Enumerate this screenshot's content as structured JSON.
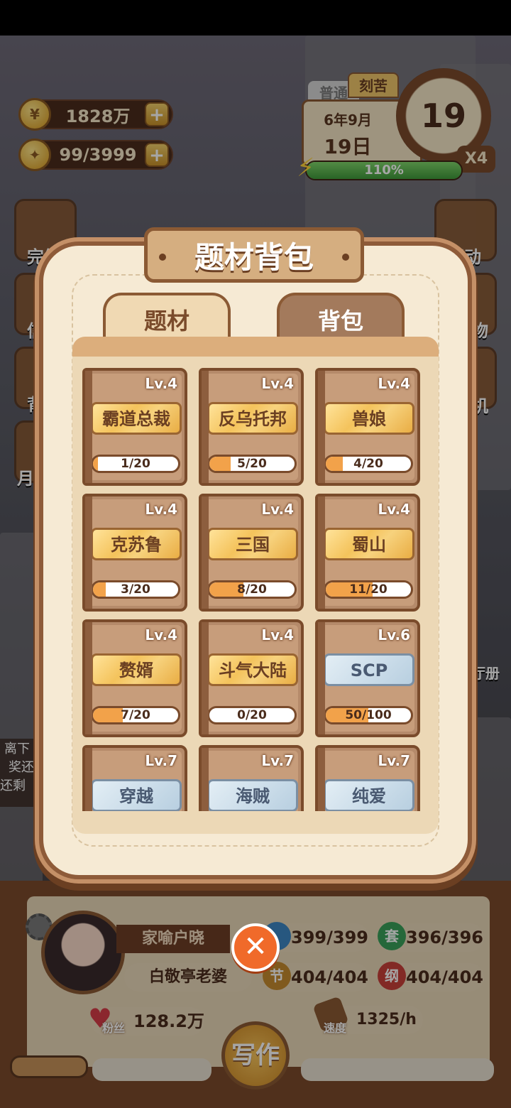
{
  "resources": {
    "coins": "1828万",
    "ideas": "99/3999"
  },
  "date_panel": {
    "tag_normal": "普通",
    "tag_hard": "刻苦",
    "month": "6年9月",
    "day": "19日",
    "clock_day": "19",
    "speed": "X4",
    "energy": "110%",
    "energy_fraction": 1.0
  },
  "side_left": [
    "完结",
    "信",
    "背",
    "月"
  ],
  "side_right": [
    "行动",
    "物",
    "机",
    "厅册"
  ],
  "side_left_extra": [
    "离下",
    "奖还",
    "还剩"
  ],
  "modal": {
    "title": "题材背包",
    "tabs": [
      {
        "label": "题材",
        "active": true
      },
      {
        "label": "背包",
        "active": false
      }
    ],
    "items": [
      {
        "name": "霸道总裁",
        "level": "Lv.4",
        "progress": "1/20",
        "fraction": 0.05,
        "style": "gold"
      },
      {
        "name": "反乌托邦",
        "level": "Lv.4",
        "progress": "5/20",
        "fraction": 0.25,
        "style": "gold"
      },
      {
        "name": "兽娘",
        "level": "Lv.4",
        "progress": "4/20",
        "fraction": 0.2,
        "style": "gold"
      },
      {
        "name": "克苏鲁",
        "level": "Lv.4",
        "progress": "3/20",
        "fraction": 0.15,
        "style": "gold"
      },
      {
        "name": "三国",
        "level": "Lv.4",
        "progress": "8/20",
        "fraction": 0.4,
        "style": "gold"
      },
      {
        "name": "蜀山",
        "level": "Lv.4",
        "progress": "11/20",
        "fraction": 0.55,
        "style": "gold"
      },
      {
        "name": "赘婿",
        "level": "Lv.4",
        "progress": "7/20",
        "fraction": 0.35,
        "style": "gold"
      },
      {
        "name": "斗气大陆",
        "level": "Lv.4",
        "progress": "0/20",
        "fraction": 0.0,
        "style": "gold"
      },
      {
        "name": "SCP",
        "level": "Lv.6",
        "progress": "50/100",
        "fraction": 0.5,
        "style": "blue"
      },
      {
        "name": "穿越",
        "level": "Lv.7",
        "progress": "",
        "fraction": 0,
        "style": "blue"
      },
      {
        "name": "海贼",
        "level": "Lv.7",
        "progress": "",
        "fraction": 0,
        "style": "blue"
      },
      {
        "name": "纯爱",
        "level": "Lv.7",
        "progress": "",
        "fraction": 0,
        "style": "blue"
      }
    ]
  },
  "profile": {
    "pen_name": "家喻户晓",
    "nickname": "白敬亭老婆",
    "stat_1": "399/399",
    "stat_2": "396/396",
    "stat_3": "404/404",
    "stat_4": "404/404",
    "stat_icon_2": "套",
    "stat_icon_3": "节",
    "stat_icon_4": "纲",
    "fans_label": "粉丝",
    "fans": "128.2万",
    "speed_label": "速度",
    "speed": "1325/h",
    "write_label": "写作"
  }
}
